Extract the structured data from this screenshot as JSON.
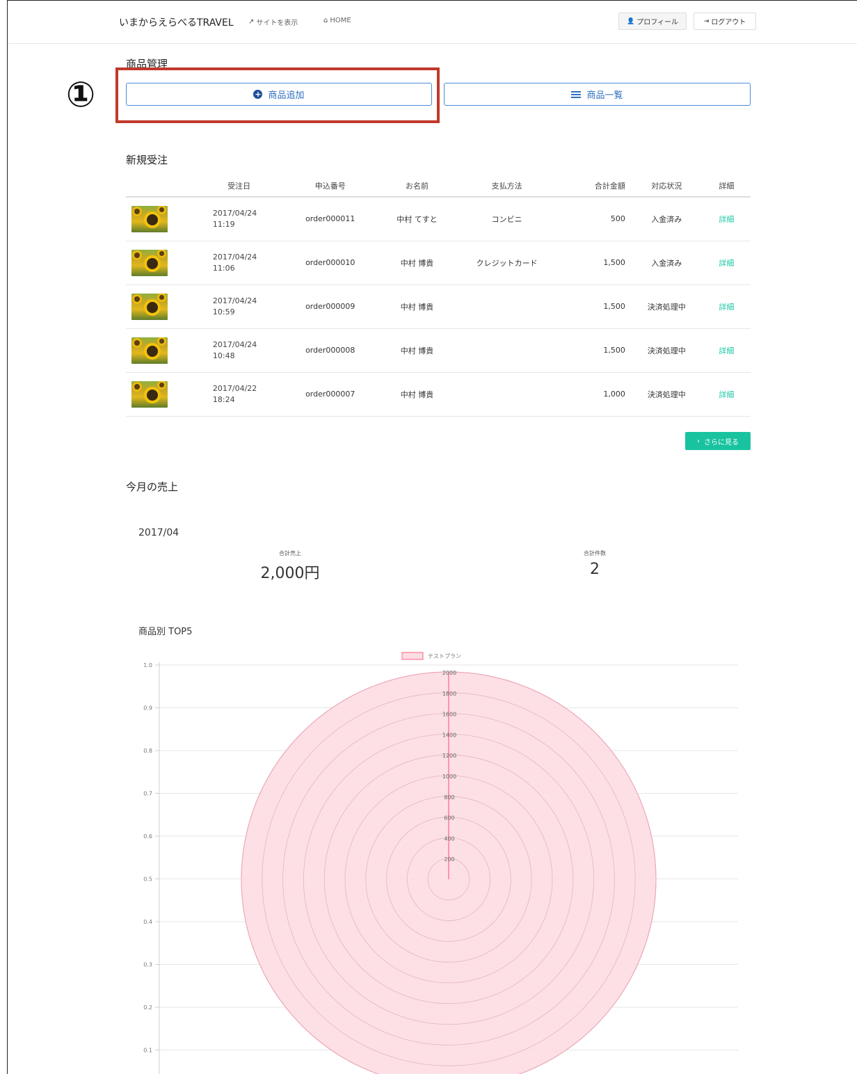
{
  "header": {
    "brand": "いまからえらべるTRAVEL",
    "view_site": "サイトを表示",
    "home": "HOME",
    "profile": "プロフィール",
    "logout": "ログアウト"
  },
  "product_mgmt": {
    "title": "商品管理",
    "add_label": "商品追加",
    "list_label": "商品一覧"
  },
  "annotation": {
    "marker": "①",
    "color": "#c0392b"
  },
  "orders": {
    "title": "新規受注",
    "columns": [
      "",
      "受注日",
      "申込番号",
      "お名前",
      "支払方法",
      "合計金額",
      "対応状況",
      "詳細"
    ],
    "rows": [
      {
        "date": "2017/04/24",
        "time": "11:19",
        "order_no": "order000011",
        "name": "中村 てすと",
        "payment": "コンビニ",
        "total": "500",
        "status": "入金済み",
        "detail": "詳細"
      },
      {
        "date": "2017/04/24",
        "time": "11:06",
        "order_no": "order000010",
        "name": "中村 博貴",
        "payment": "クレジットカード",
        "total": "1,500",
        "status": "入金済み",
        "detail": "詳細"
      },
      {
        "date": "2017/04/24",
        "time": "10:59",
        "order_no": "order000009",
        "name": "中村 博貴",
        "payment": "",
        "total": "1,500",
        "status": "決済処理中",
        "detail": "詳細"
      },
      {
        "date": "2017/04/24",
        "time": "10:48",
        "order_no": "order000008",
        "name": "中村 博貴",
        "payment": "",
        "total": "1,500",
        "status": "決済処理中",
        "detail": "詳細"
      },
      {
        "date": "2017/04/22",
        "time": "18:24",
        "order_no": "order000007",
        "name": "中村 博貴",
        "payment": "",
        "total": "1,000",
        "status": "決済処理中",
        "detail": "詳細"
      }
    ],
    "more_label": "さらに見る",
    "accent": "#19c3a0"
  },
  "sales": {
    "title": "今月の売上",
    "month": "2017/04",
    "total_label": "合計売上",
    "total_value": "2,000円",
    "count_label": "合計件数",
    "count_value": "2"
  },
  "top5": {
    "title": "商品別 TOP5"
  },
  "chart_data": {
    "type": "polarArea",
    "legend": [
      "テストプラン"
    ],
    "legend_position": "top",
    "series": [
      {
        "name": "テストプラン",
        "values": [
          2000
        ]
      }
    ],
    "y_ticks": [
      "1.0",
      "0.9",
      "0.8",
      "0.7",
      "0.6",
      "0.5",
      "0.4",
      "0.3",
      "0.2",
      "0.1"
    ],
    "r_ticks": [
      "2000",
      "1800",
      "1600",
      "1400",
      "1200",
      "1000",
      "800",
      "600",
      "400",
      "200"
    ],
    "r_max": 2000,
    "fill": "#fcdde3",
    "stroke": "#ff6384"
  }
}
